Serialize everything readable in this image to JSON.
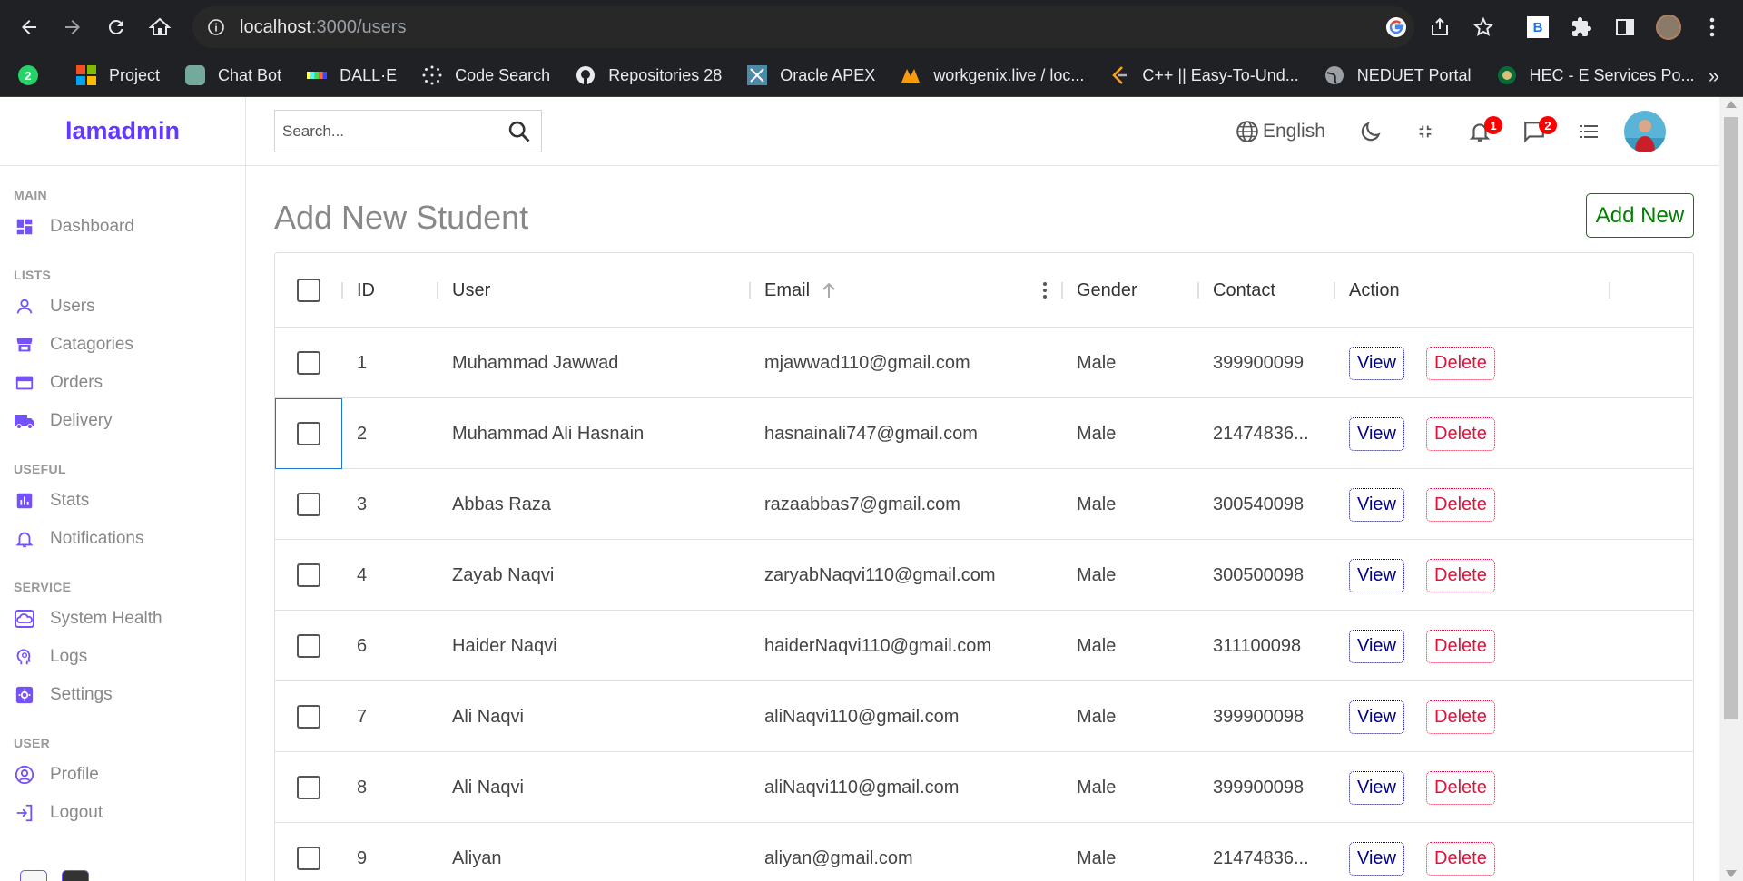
{
  "browser": {
    "url_host": "localhost",
    "url_rest": ":3000/users",
    "bookmarks": [
      {
        "label": "",
        "icon": "whatsapp-icon"
      },
      {
        "label": "Project",
        "icon": "microsoft-icon"
      },
      {
        "label": "Chat Bot",
        "icon": "openai-icon"
      },
      {
        "label": "DALL·E",
        "icon": "dalle-icon"
      },
      {
        "label": "Code Search",
        "icon": "dots-icon"
      },
      {
        "label": "Repositories 28",
        "icon": "github-icon"
      },
      {
        "label": "Oracle APEX",
        "icon": "apex-icon"
      },
      {
        "label": "workgenix.live / loc...",
        "icon": "phpmyadmin-icon"
      },
      {
        "label": "C++ || Easy-To-Und...",
        "icon": "leetcode-icon"
      },
      {
        "label": "NEDUET Portal",
        "icon": "globe-icon"
      },
      {
        "label": "HEC - E Services Po...",
        "icon": "hec-icon"
      }
    ],
    "more": "»"
  },
  "sidebar": {
    "logo": "lamadmin",
    "sections": [
      {
        "title": "MAIN",
        "items": [
          {
            "label": "Dashboard",
            "icon": "dashboard-icon"
          }
        ]
      },
      {
        "title": "LISTS",
        "items": [
          {
            "label": "Users",
            "icon": "person-icon"
          },
          {
            "label": "Catagories",
            "icon": "store-icon"
          },
          {
            "label": "Orders",
            "icon": "credit-card-icon"
          },
          {
            "label": "Delivery",
            "icon": "truck-icon"
          }
        ]
      },
      {
        "title": "USEFUL",
        "items": [
          {
            "label": "Stats",
            "icon": "chart-icon"
          },
          {
            "label": "Notifications",
            "icon": "bell-icon"
          }
        ]
      },
      {
        "title": "SERVICE",
        "items": [
          {
            "label": "System Health",
            "icon": "cloud-icon"
          },
          {
            "label": "Logs",
            "icon": "psychology-icon"
          },
          {
            "label": "Settings",
            "icon": "settings-icon"
          }
        ]
      },
      {
        "title": "USER",
        "items": [
          {
            "label": "Profile",
            "icon": "account-icon"
          },
          {
            "label": "Logout",
            "icon": "exit-icon"
          }
        ]
      }
    ]
  },
  "topbar": {
    "search_placeholder": "Search...",
    "language": "English",
    "notifications_count": "1",
    "messages_count": "2"
  },
  "main": {
    "title": "Add New Student",
    "add_button": "Add New",
    "columns": [
      "ID",
      "User",
      "Email",
      "Gender",
      "Contact",
      "Action"
    ],
    "view_label": "View",
    "delete_label": "Delete",
    "rows": [
      {
        "id": "1",
        "user": "Muhammad Jawwad",
        "email": "mjawwad110@gmail.com",
        "gender": "Male",
        "contact": "399900099"
      },
      {
        "id": "2",
        "user": "Muhammad Ali Hasnain",
        "email": "hasnainali747@gmail.com",
        "gender": "Male",
        "contact": "21474836..."
      },
      {
        "id": "3",
        "user": "Abbas Raza",
        "email": "razaabbas7@gmail.com",
        "gender": "Male",
        "contact": "300540098"
      },
      {
        "id": "4",
        "user": "Zayab Naqvi",
        "email": "zaryabNaqvi110@gmail.com",
        "gender": "Male",
        "contact": "300500098"
      },
      {
        "id": "6",
        "user": "Haider Naqvi",
        "email": "haiderNaqvi110@gmail.com",
        "gender": "Male",
        "contact": "311100098"
      },
      {
        "id": "7",
        "user": "Ali Naqvi",
        "email": "aliNaqvi110@gmail.com",
        "gender": "Male",
        "contact": "399900098"
      },
      {
        "id": "8",
        "user": "Ali Naqvi",
        "email": "aliNaqvi110@gmail.com",
        "gender": "Male",
        "contact": "399900098"
      },
      {
        "id": "9",
        "user": "Aliyan",
        "email": "aliyan@gmail.com",
        "gender": "Male",
        "contact": "21474836..."
      }
    ]
  },
  "colors": {
    "brand": "#6439ff",
    "icon": "#7451f8",
    "add": "#008000",
    "view": "#00008b",
    "delete": "#dc143c"
  }
}
